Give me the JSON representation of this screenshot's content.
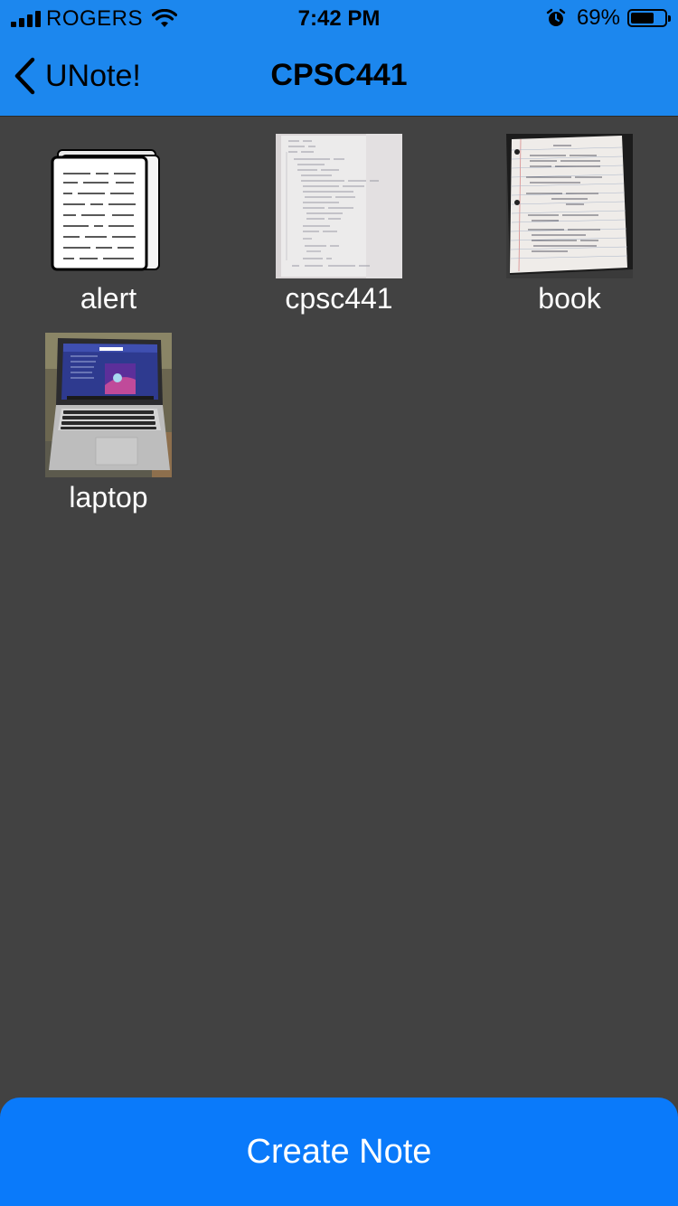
{
  "status_bar": {
    "carrier": "ROGERS",
    "time": "7:42 PM",
    "battery_percent": "69%",
    "battery_level": 0.69,
    "icons": [
      "signal-icon",
      "wifi-icon",
      "alarm-icon",
      "battery-icon"
    ]
  },
  "nav": {
    "back_label": "UNote!",
    "title": "CPSC441"
  },
  "notes": [
    {
      "label": "alert",
      "thumbnail": "document-icon"
    },
    {
      "label": "cpsc441",
      "thumbnail": "handwritten-page-photo"
    },
    {
      "label": "book",
      "thumbnail": "lined-notebook-page-photo"
    },
    {
      "label": "laptop",
      "thumbnail": "laptop-photo"
    }
  ],
  "create_button": {
    "label": "Create Note"
  },
  "colors": {
    "bar": "#1c87ee",
    "background": "#424242",
    "button": "#0a7afa",
    "text_on_dark": "#ffffff"
  }
}
